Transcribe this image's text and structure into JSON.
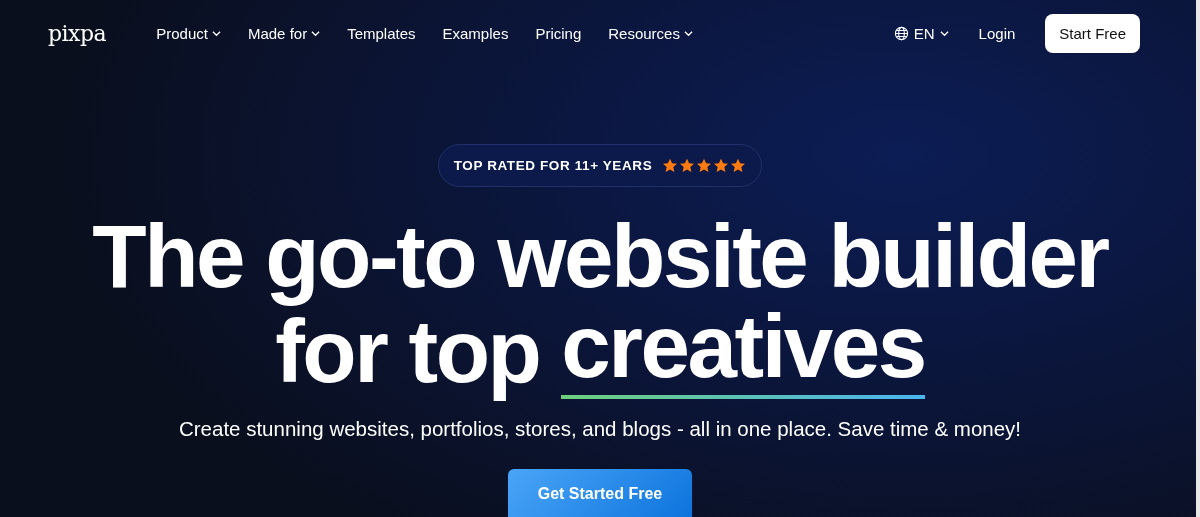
{
  "logo": "pixpa",
  "nav": [
    {
      "label": "Product",
      "has_menu": true
    },
    {
      "label": "Made for",
      "has_menu": true
    },
    {
      "label": "Templates",
      "has_menu": false
    },
    {
      "label": "Examples",
      "has_menu": false
    },
    {
      "label": "Pricing",
      "has_menu": false
    },
    {
      "label": "Resources",
      "has_menu": true
    }
  ],
  "language": {
    "label": "EN",
    "has_menu": true
  },
  "login": "Login",
  "start_button": "Start Free",
  "badge": {
    "text": "TOP RATED FOR 11+ YEARS",
    "stars": 5
  },
  "headline": {
    "line_1": "The go-to website builder",
    "line_2": "for top",
    "highlight": "creatives"
  },
  "subtitle": "Create stunning websites, portfolios, stores, and blogs - all in one place. Save time & money!",
  "cta_button": "Get Started Free"
}
